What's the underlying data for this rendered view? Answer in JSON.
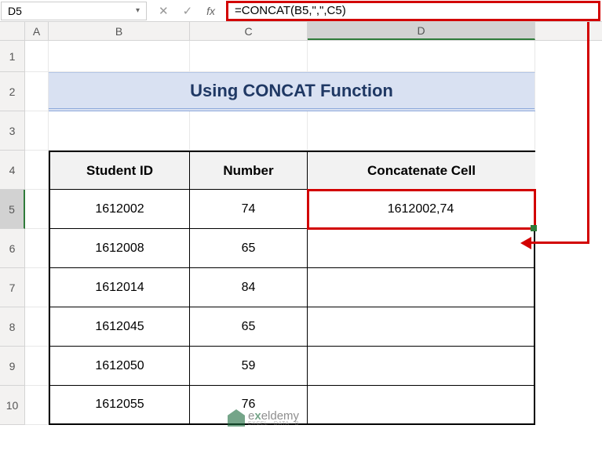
{
  "namebox": {
    "value": "D5"
  },
  "fx": {
    "cancel": "✕",
    "confirm": "✓",
    "label": "fx"
  },
  "formula": "=CONCAT(B5,\",\",C5)",
  "colHeaders": [
    "A",
    "B",
    "C",
    "D"
  ],
  "rowHeaders": [
    "1",
    "2",
    "3",
    "4",
    "5",
    "6",
    "7",
    "8",
    "9",
    "10"
  ],
  "title": "Using CONCAT Function",
  "table": {
    "headers": {
      "b": "Student ID",
      "c": "Number",
      "d": "Concatenate Cell"
    },
    "rows": [
      {
        "b": "1612002",
        "c": "74",
        "d": "1612002,74"
      },
      {
        "b": "1612008",
        "c": "65",
        "d": ""
      },
      {
        "b": "1612014",
        "c": "84",
        "d": ""
      },
      {
        "b": "1612045",
        "c": "65",
        "d": ""
      },
      {
        "b": "1612050",
        "c": "59",
        "d": ""
      },
      {
        "b": "1612055",
        "c": "76",
        "d": ""
      }
    ]
  },
  "watermark": {
    "brand_pre": "e",
    "brand_mid": "x",
    "brand_post": "eldemy",
    "sub": "EXCEL · DATA · B"
  },
  "icons": {
    "dropdown": "▾"
  }
}
